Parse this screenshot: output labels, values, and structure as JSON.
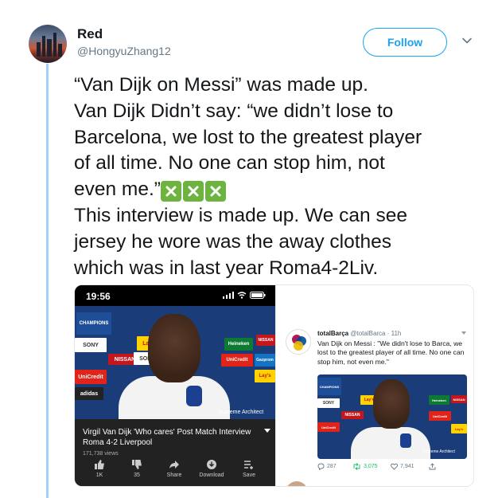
{
  "user": {
    "name": "Red",
    "handle": "@HongyuZhang12"
  },
  "follow_label": "Follow",
  "tweet": {
    "lines": [
      "“Van Dijk on Messi” was made up.",
      "Van Dijk Didn’t say: “we didn’t lose to",
      "Barcelona, we lost to the greatest player",
      "of all time. No one can stop him, not",
      "even me.”",
      "This interview is made up. We can see",
      "jersey he wore was the away clothes",
      "which was in last year Roma4-2Liv."
    ],
    "emoji": [
      "cross-mark-button",
      "cross-mark-button",
      "cross-mark-button"
    ]
  },
  "phone": {
    "time": "19:56",
    "video_title": "Virgil Van Dijk 'Who cares' Post Match Interview Roma 4-2 Liverpool",
    "views": "171,738 views",
    "watermark": "Supreme Architect",
    "actions": [
      {
        "icon": "thumbs-up-icon",
        "label": "1K"
      },
      {
        "icon": "thumbs-down-icon",
        "label": "35"
      },
      {
        "icon": "share-icon",
        "label": "Share"
      },
      {
        "icon": "download-icon",
        "label": "Download"
      },
      {
        "icon": "save-icon",
        "label": "Save"
      }
    ]
  },
  "embed": {
    "name": "totalBarça",
    "handle": "@totalBarca",
    "time": "11h",
    "text": "Van Dijk on Messi : \"We didn't lose to Barca, we lost to the greatest player of all time. No one can stop him, not even me.\"",
    "watermark": "Supreme Architect",
    "replies": "287",
    "retweets": "3,075",
    "likes": "7,941"
  },
  "board_labels": {
    "champions": "CHAMPIONS",
    "nissan": "NISSAN",
    "sony": "SONY",
    "unicredit": "UniCredit",
    "lays": "Lay's",
    "heineken": "Heineken",
    "gazprom": "Gazprom",
    "adidas": "adidas"
  },
  "colors": {
    "accent": "#1da1f2",
    "thread_line": "#a4d0f7",
    "retweet_green": "#17bf63",
    "emoji_green": "#6cb33f"
  }
}
